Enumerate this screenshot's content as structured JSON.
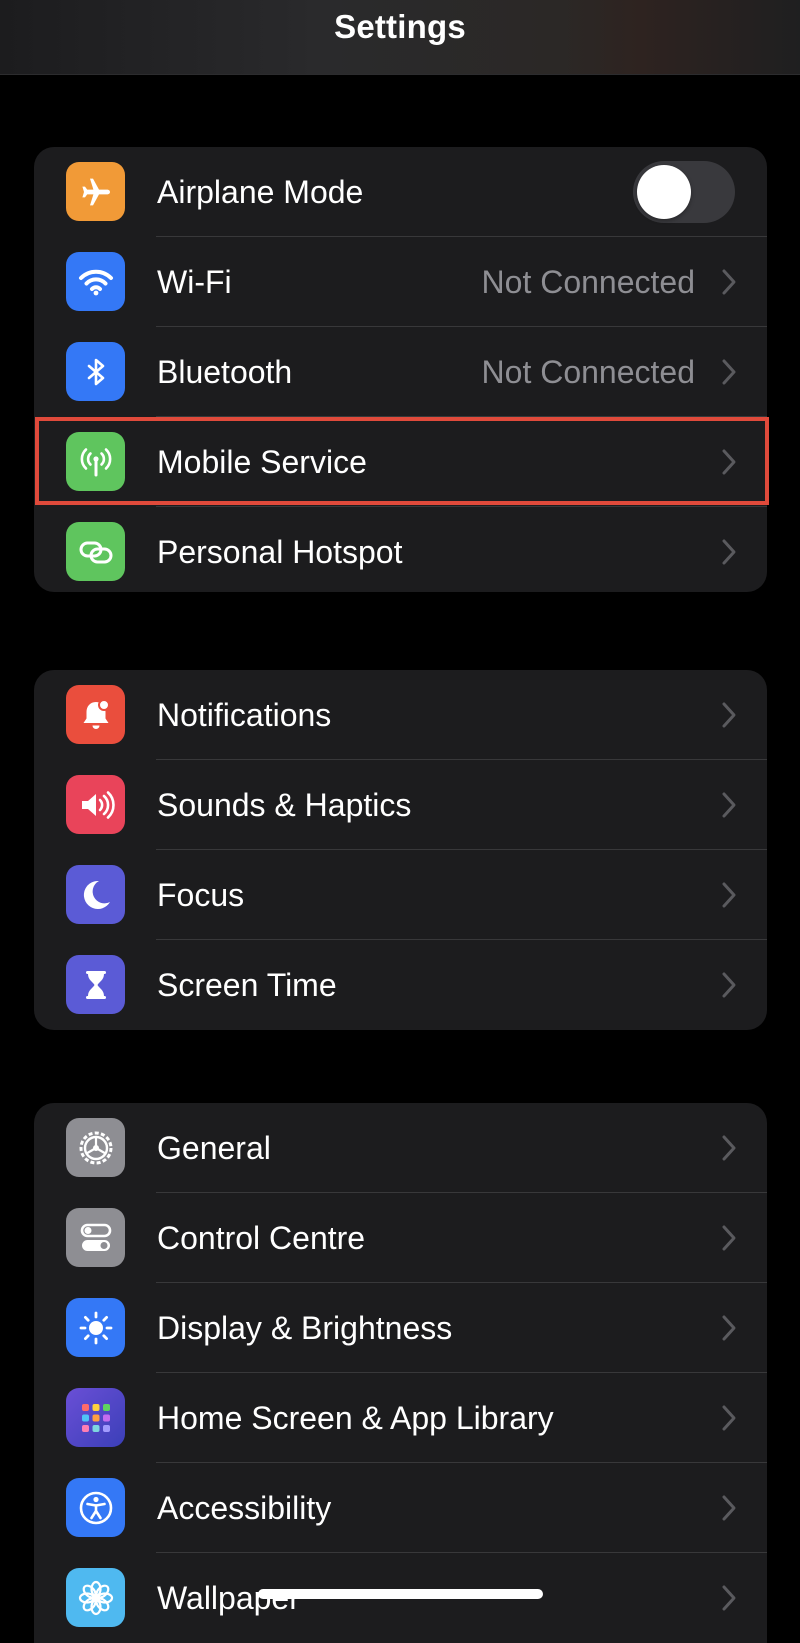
{
  "header": {
    "title": "Settings"
  },
  "groups": {
    "connectivity": {
      "airplane": {
        "label": "Airplane Mode",
        "icon": "airplane-icon",
        "color": "#f19a37",
        "toggle_on": false
      },
      "wifi": {
        "label": "Wi-Fi",
        "value": "Not Connected",
        "icon": "wifi-icon",
        "color": "#3478f6"
      },
      "bluetooth": {
        "label": "Bluetooth",
        "value": "Not Connected",
        "icon": "bluetooth-icon",
        "color": "#3478f6"
      },
      "mobile": {
        "label": "Mobile Service",
        "icon": "antenna-icon",
        "color": "#5fc55e"
      },
      "hotspot": {
        "label": "Personal Hotspot",
        "icon": "link-icon",
        "color": "#5fc55e"
      }
    },
    "alerts": {
      "notifications": {
        "label": "Notifications",
        "icon": "bell-icon",
        "color": "#ea4e3d"
      },
      "sounds": {
        "label": "Sounds & Haptics",
        "icon": "speaker-icon",
        "color": "#e9445a"
      },
      "focus": {
        "label": "Focus",
        "icon": "moon-icon",
        "color": "#5b5bd6"
      },
      "screen_time": {
        "label": "Screen Time",
        "icon": "hourglass-icon",
        "color": "#5b5bd6"
      }
    },
    "system": {
      "general": {
        "label": "General",
        "icon": "gear-icon",
        "color": "#8e8e93"
      },
      "control_centre": {
        "label": "Control Centre",
        "icon": "toggles-icon",
        "color": "#8e8e93"
      },
      "display": {
        "label": "Display & Brightness",
        "icon": "sun-icon",
        "color": "#3478f6"
      },
      "home_screen": {
        "label": "Home Screen & App Library",
        "icon": "app-grid-icon",
        "color": "#4b3fc4"
      },
      "accessibility": {
        "label": "Accessibility",
        "icon": "accessibility-icon",
        "color": "#3478f6"
      },
      "wallpaper": {
        "label": "Wallpaper",
        "icon": "flower-icon",
        "color": "#4fb9f0"
      }
    }
  },
  "colors": {
    "background": "#000000",
    "group_background": "#1c1c1e",
    "secondary_text": "#8e8e93",
    "highlight": "#e04a3b"
  }
}
